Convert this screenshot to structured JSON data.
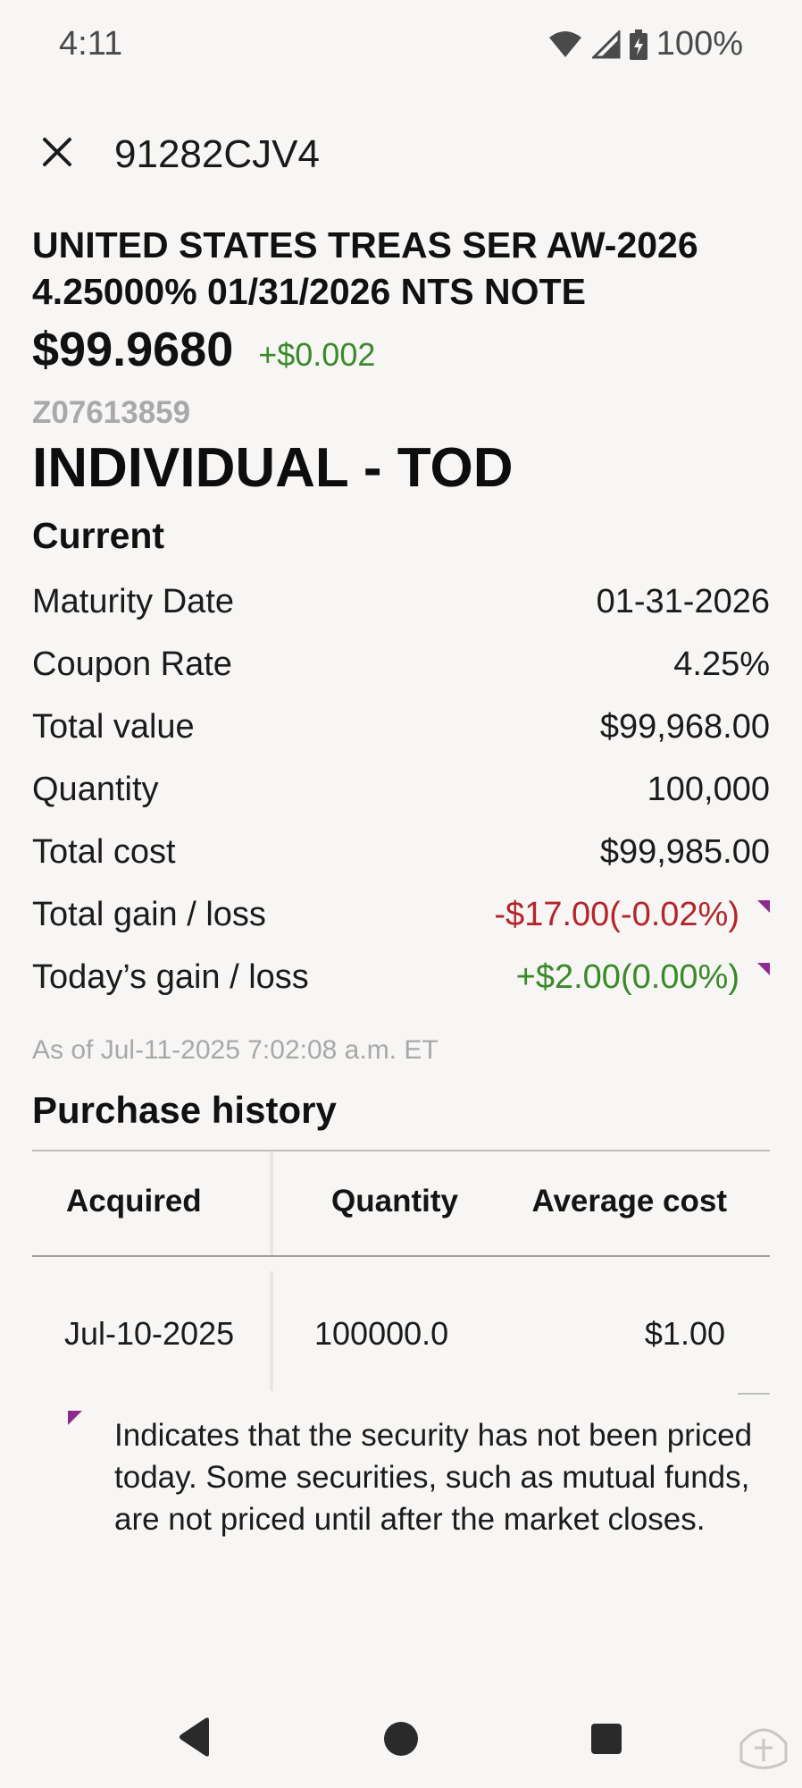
{
  "status_bar": {
    "time": "4:11",
    "battery": "100%"
  },
  "header": {
    "symbol": "91282CJV4"
  },
  "security": {
    "name": "UNITED STATES TREAS SER AW-2026 4.25000% 01/31/2026 NTS NOTE",
    "price": "$99.9680",
    "price_change": "+$0.002"
  },
  "account": {
    "number": "Z07613859",
    "name": "INDIVIDUAL - TOD"
  },
  "current": {
    "title": "Current",
    "rows": [
      {
        "label": "Maturity Date",
        "value": "01-31-2026"
      },
      {
        "label": "Coupon Rate",
        "value": "4.25%"
      },
      {
        "label": "Total value",
        "value": "$99,968.00"
      },
      {
        "label": "Quantity",
        "value": "100,000"
      },
      {
        "label": "Total cost",
        "value": "$99,985.00"
      },
      {
        "label": "Total gain / loss",
        "value": "-$17.00(-0.02%)"
      },
      {
        "label": "Today’s gain / loss",
        "value": "+$2.00(0.00%)"
      }
    ],
    "as_of": "As of Jul-11-2025 7:02:08 a.m. ET"
  },
  "purchase_history": {
    "title": "Purchase history",
    "columns": [
      "Acquired",
      "Quantity",
      "Average cost"
    ],
    "rows": [
      {
        "acquired": "Jul-10-2025",
        "quantity": "100000.0",
        "average_cost": "$1.00"
      }
    ]
  },
  "legend": {
    "text": "Indicates that the security has not been priced today. Some securities, such as mutual funds, are not priced until after the market closes."
  },
  "colors": {
    "negative": "#b3262b",
    "positive": "#3a8a2a",
    "flag": "#8e2a8e"
  }
}
